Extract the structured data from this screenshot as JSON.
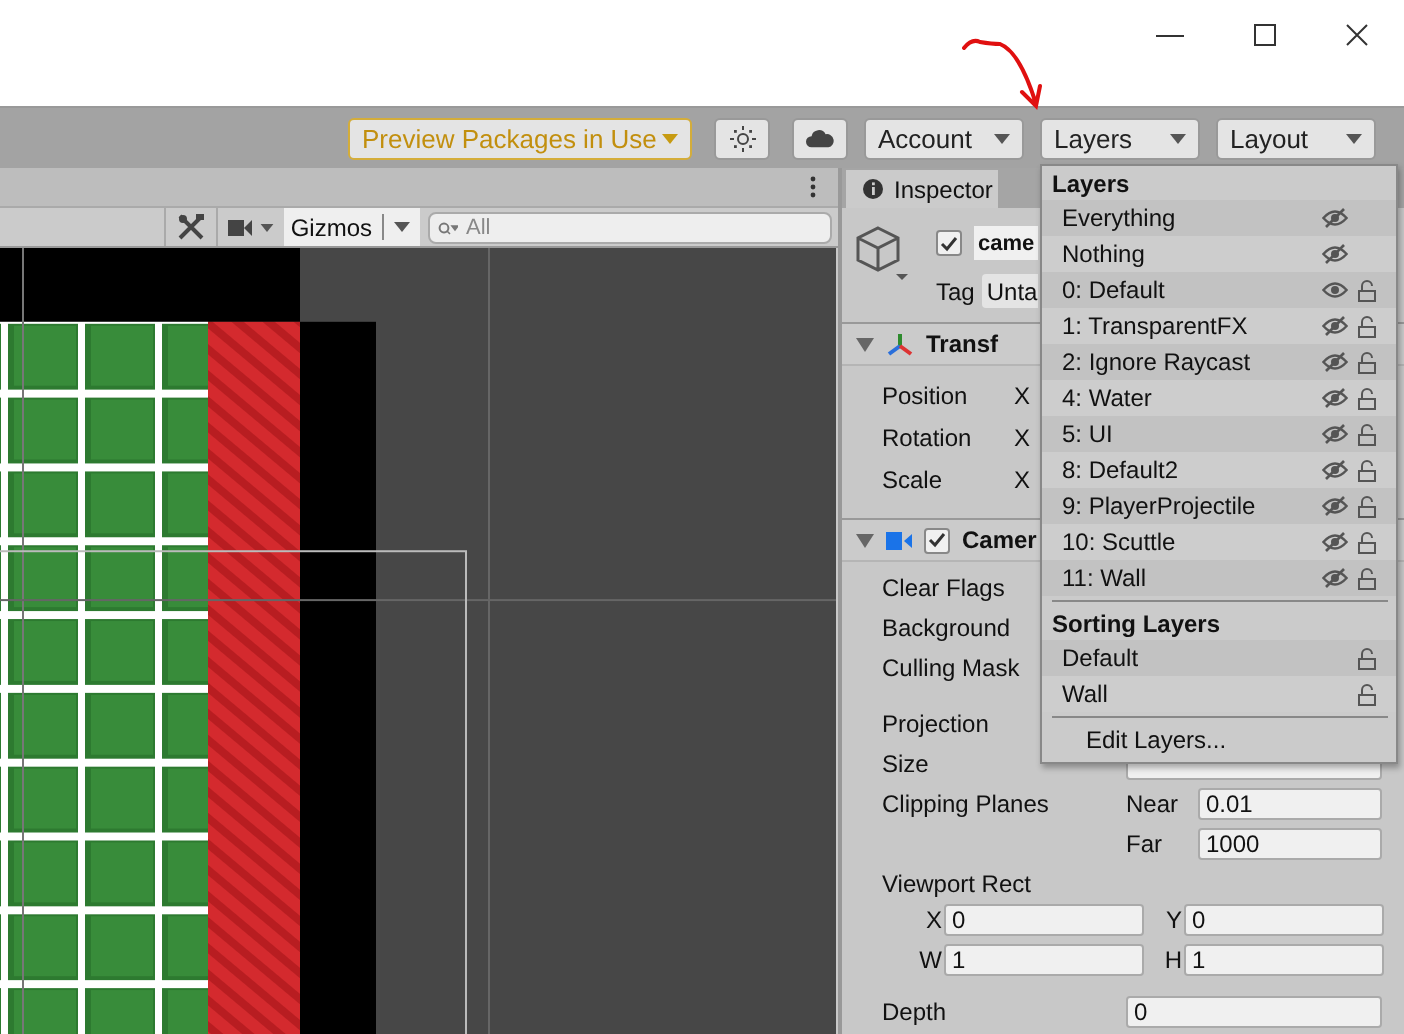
{
  "toolbar": {
    "preview_button": "Preview Packages in Use",
    "account": "Account",
    "layers": "Layers",
    "layout": "Layout"
  },
  "scene": {
    "gizmos": "Gizmos",
    "search": {
      "placeholder": "All"
    }
  },
  "inspector": {
    "tab": "Inspector",
    "object": {
      "active": true,
      "name": "came",
      "tag_label": "Tag",
      "tag": "Unta"
    },
    "transform": {
      "expanded": true,
      "title": "Transf",
      "rows": [
        {
          "label": "Position",
          "axis": "X"
        },
        {
          "label": "Rotation",
          "axis": "X"
        },
        {
          "label": "Scale",
          "axis": "X"
        }
      ]
    },
    "camera": {
      "expanded": true,
      "enabled": true,
      "title": "Camer",
      "labels": [
        "Clear Flags",
        "Background",
        "Culling Mask"
      ],
      "projection": "Projection",
      "size": "Size",
      "clipping": {
        "label": "Clipping Planes",
        "near_label": "Near",
        "near": "0.01",
        "far_label": "Far",
        "far": "1000"
      },
      "viewport": {
        "label": "Viewport Rect",
        "fields": [
          {
            "axis": "X",
            "value": "0"
          },
          {
            "axis": "Y",
            "value": "0"
          },
          {
            "axis": "W",
            "value": "1"
          },
          {
            "axis": "H",
            "value": "1"
          }
        ]
      },
      "depth": {
        "label": "Depth",
        "value": "0"
      }
    }
  },
  "layers_menu": {
    "title": "Layers",
    "layers": [
      {
        "name": "Everything",
        "visible": false
      },
      {
        "name": "Nothing",
        "visible": false
      },
      {
        "name": "0: Default",
        "visible": true,
        "locked": false
      },
      {
        "name": "1: TransparentFX",
        "visible": false,
        "locked": false
      },
      {
        "name": "2: Ignore Raycast",
        "visible": false,
        "locked": false
      },
      {
        "name": "4: Water",
        "visible": false,
        "locked": false
      },
      {
        "name": "5: UI",
        "visible": false,
        "locked": false
      },
      {
        "name": "8: Default2",
        "visible": false,
        "locked": false
      },
      {
        "name": "9: PlayerProjectile",
        "visible": false,
        "locked": false
      },
      {
        "name": "10: Scuttle",
        "visible": false,
        "locked": false
      },
      {
        "name": "11: Wall",
        "visible": false,
        "locked": false
      }
    ],
    "sorting_title": "Sorting Layers",
    "sorting_layers": [
      {
        "name": "Default",
        "locked": false
      },
      {
        "name": "Wall",
        "locked": false
      }
    ],
    "edit": "Edit Layers..."
  }
}
